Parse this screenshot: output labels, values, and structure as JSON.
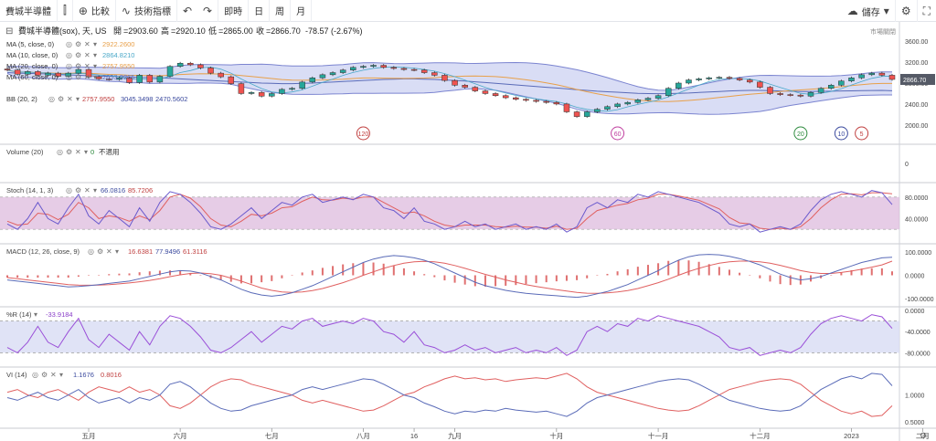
{
  "toolbar": {
    "symbol": "費城半導體",
    "compare_label": "比較",
    "indicators_label": "技術指標",
    "intervals": [
      "即時",
      "日",
      "周",
      "月"
    ],
    "save_label": "儲存"
  },
  "header": {
    "title": "費城半導體(sox), 天, US",
    "open_label": "開",
    "open": "=2903.60",
    "high_label": "高",
    "high": "=2920.10",
    "low_label": "低",
    "low": "=2865.00",
    "close_label": "收",
    "close": "=2866.70",
    "change": "-78.57 (-2.67%)",
    "market_label": "市場關閉"
  },
  "overlays": [
    {
      "label": "MA (5, close, 0)",
      "value": "2922.2600",
      "color": "#e8a04a"
    },
    {
      "label": "MA (10, close, 0)",
      "value": "2864.8210",
      "color": "#4aa8c8"
    },
    {
      "label": "MA (20, close, 0)",
      "value": "2757.9550",
      "color": "#e8a04a"
    },
    {
      "label": "MA (60, close, 0)",
      "value": "2653.0265",
      "color": "#5a6bb8"
    }
  ],
  "bb": {
    "label": "BB (20, 2)",
    "mid": "2757.9550",
    "upper": "3045.3498",
    "lower": "2470.5602"
  },
  "volume": {
    "label": "Volume (20)",
    "value": "0",
    "note": "不適用"
  },
  "stoch": {
    "label": "Stoch (14, 1, 3)",
    "k": "66.0816",
    "d": "85.7206"
  },
  "macd": {
    "label": "MACD (12, 26, close, 9)",
    "hist": "16.6381",
    "macd": "77.9496",
    "signal": "61.3116"
  },
  "willr": {
    "label": "%R (14)",
    "value": "-33.9184"
  },
  "vi": {
    "label": "VI (14)",
    "plus": "1.1676",
    "minus": "0.8016"
  },
  "price_badge": "2866.70",
  "markers": [
    {
      "label": "120",
      "color": "#c04040",
      "index": 35
    },
    {
      "label": "60",
      "color": "#c040a0",
      "index": 60
    },
    {
      "label": "20",
      "color": "#2e8b3e",
      "index": 78
    },
    {
      "label": "10",
      "color": "#3b4a9e",
      "index": 82
    },
    {
      "label": "5",
      "color": "#c04040",
      "index": 84
    }
  ],
  "colors": {
    "up": "#26a69a",
    "down": "#ef5350",
    "bb_fill": "#c5cbf0",
    "bb_line": "#7b84d0",
    "stoch_fill": "#dbb6dc",
    "stoch_k": "#6a5acd",
    "stoch_d": "#e06060",
    "macd_line": "#5a6bb8",
    "signal_line": "#e06060",
    "hist": "#e07070",
    "willr_fill": "#d8dcf4",
    "willr_line": "#9a4fd8",
    "vi_plus": "#5a6bb8",
    "vi_minus": "#e06060"
  },
  "chart_data": {
    "type": "line",
    "x_ticks": [
      "五月",
      "六月",
      "七月",
      "八月",
      "16",
      "九月",
      "十月",
      "十一月",
      "十二月",
      "2023",
      "二月"
    ],
    "x_tick_index": [
      8,
      17,
      26,
      35,
      40,
      44,
      54,
      64,
      74,
      83,
      90
    ],
    "price": {
      "ylim": [
        1700,
        3900
      ],
      "y_ticks": [
        3600,
        3200,
        2800,
        2400,
        2000
      ],
      "y_tick_labels": [
        "3600.00",
        "3200.00",
        "2800.00",
        "2400.00",
        "2000.00"
      ],
      "close": [
        3050,
        2970,
        3020,
        2950,
        2990,
        2930,
        2990,
        3060,
        2920,
        2880,
        2870,
        2900,
        2810,
        2950,
        2820,
        2930,
        3120,
        3180,
        3150,
        3090,
        2990,
        2920,
        2790,
        2600,
        2620,
        2550,
        2600,
        2680,
        2700,
        2820,
        2900,
        2960,
        3000,
        3050,
        3100,
        3120,
        3140,
        3100,
        3080,
        3060,
        3050,
        3000,
        2950,
        2850,
        2760,
        2720,
        2650,
        2600,
        2560,
        2520,
        2490,
        2470,
        2450,
        2430,
        2400,
        2250,
        2160,
        2250,
        2300,
        2350,
        2400,
        2430,
        2480,
        2510,
        2560,
        2700,
        2800,
        2860,
        2880,
        2900,
        2910,
        2890,
        2860,
        2820,
        2720,
        2600,
        2580,
        2570,
        2550,
        2620,
        2700,
        2760,
        2840,
        2900,
        2960,
        2990,
        2950,
        2870
      ],
      "ma_long": [
        3000,
        2990,
        2985,
        2980,
        2975,
        2965,
        2955,
        2950,
        2940,
        2935,
        2930,
        2925,
        2920,
        2910,
        2905,
        2900,
        2890,
        2880,
        2870,
        2860,
        2850,
        2840,
        2830,
        2820,
        2810,
        2800,
        2795,
        2790,
        2790,
        2795,
        2800,
        2810,
        2820,
        2830,
        2840,
        2850,
        2860,
        2870,
        2875,
        2880,
        2880,
        2875,
        2870,
        2860,
        2850,
        2840,
        2825,
        2810,
        2795,
        2780,
        2765,
        2750,
        2735,
        2720,
        2705,
        2690,
        2675,
        2660,
        2645,
        2635,
        2625,
        2615,
        2605,
        2600,
        2598,
        2600,
        2605,
        2610,
        2620,
        2630,
        2640,
        2650,
        2655,
        2660,
        2660,
        2655,
        2650,
        2645,
        2640,
        2640,
        2642,
        2645,
        2650,
        2652,
        2655,
        2658,
        2660,
        2653
      ]
    },
    "volume": {
      "ylim": [
        -1,
        1
      ],
      "y_ticks": [
        0
      ],
      "y_tick_labels": [
        "0"
      ]
    },
    "stoch": {
      "ylim": [
        0,
        100
      ],
      "band": [
        20,
        80
      ],
      "y_ticks": [
        80,
        40
      ],
      "y_tick_labels": [
        "80.0000",
        "40.0000"
      ],
      "k": [
        30,
        20,
        40,
        70,
        40,
        30,
        60,
        85,
        45,
        30,
        55,
        40,
        25,
        60,
        35,
        70,
        90,
        85,
        70,
        50,
        25,
        20,
        30,
        45,
        60,
        40,
        55,
        70,
        65,
        80,
        85,
        70,
        75,
        80,
        75,
        85,
        80,
        60,
        55,
        40,
        60,
        35,
        30,
        20,
        25,
        35,
        25,
        30,
        20,
        25,
        30,
        20,
        25,
        20,
        30,
        15,
        25,
        60,
        70,
        60,
        75,
        70,
        85,
        80,
        90,
        85,
        80,
        75,
        70,
        60,
        50,
        30,
        25,
        30,
        15,
        20,
        25,
        20,
        30,
        55,
        75,
        85,
        90,
        85,
        80,
        92,
        88,
        66
      ],
      "d": [
        35,
        28,
        30,
        50,
        48,
        38,
        48,
        70,
        60,
        40,
        45,
        42,
        35,
        45,
        38,
        55,
        80,
        85,
        78,
        62,
        40,
        28,
        25,
        35,
        48,
        45,
        50,
        60,
        62,
        72,
        80,
        75,
        74,
        78,
        76,
        80,
        80,
        70,
        60,
        50,
        52,
        45,
        35,
        28,
        25,
        28,
        28,
        28,
        25,
        24,
        26,
        24,
        24,
        22,
        26,
        20,
        22,
        40,
        55,
        60,
        65,
        68,
        75,
        78,
        85,
        85,
        82,
        78,
        74,
        66,
        58,
        42,
        32,
        30,
        22,
        20,
        22,
        20,
        25,
        40,
        60,
        75,
        85,
        86,
        84,
        88,
        88,
        86
      ]
    },
    "macd": {
      "ylim": [
        -120,
        120
      ],
      "y_ticks": [
        100,
        0,
        -100
      ],
      "y_tick_labels": [
        "100.0000",
        "0.0000",
        "-100.0000"
      ],
      "macd": [
        -20,
        -25,
        -30,
        -35,
        -40,
        -45,
        -50,
        -48,
        -45,
        -40,
        -35,
        -30,
        -25,
        -15,
        -5,
        5,
        15,
        20,
        18,
        10,
        -5,
        -20,
        -40,
        -60,
        -75,
        -85,
        -90,
        -85,
        -75,
        -60,
        -45,
        -25,
        -5,
        15,
        35,
        55,
        70,
        80,
        85,
        82,
        75,
        65,
        50,
        30,
        10,
        -10,
        -30,
        -45,
        -55,
        -65,
        -72,
        -78,
        -82,
        -85,
        -88,
        -92,
        -95,
        -90,
        -80,
        -70,
        -55,
        -40,
        -20,
        0,
        20,
        45,
        65,
        80,
        88,
        90,
        88,
        82,
        72,
        60,
        45,
        25,
        5,
        -10,
        -20,
        -15,
        -5,
        10,
        25,
        40,
        55,
        65,
        75,
        78
      ],
      "signal": [
        -10,
        -15,
        -20,
        -25,
        -30,
        -35,
        -40,
        -42,
        -43,
        -42,
        -40,
        -37,
        -33,
        -28,
        -22,
        -15,
        -6,
        2,
        8,
        10,
        7,
        0,
        -12,
        -25,
        -40,
        -55,
        -65,
        -72,
        -74,
        -72,
        -66,
        -57,
        -45,
        -32,
        -17,
        0,
        15,
        30,
        42,
        52,
        58,
        60,
        58,
        52,
        42,
        30,
        17,
        4,
        -8,
        -20,
        -30,
        -40,
        -48,
        -55,
        -62,
        -68,
        -74,
        -77,
        -78,
        -76,
        -72,
        -66,
        -57,
        -45,
        -32,
        -17,
        0,
        16,
        30,
        42,
        52,
        58,
        61,
        61,
        58,
        52,
        43,
        32,
        20,
        12,
        8,
        8,
        12,
        18,
        26,
        35,
        45,
        61
      ]
    },
    "willr": {
      "ylim": [
        -100,
        0
      ],
      "band": [
        -80,
        -20
      ],
      "y_ticks": [
        0,
        -40,
        -80
      ],
      "y_tick_labels": [
        "0.0000",
        "-40.0000",
        "-80.0000"
      ],
      "values": [
        -70,
        -80,
        -60,
        -30,
        -60,
        -70,
        -40,
        -15,
        -55,
        -70,
        -45,
        -60,
        -75,
        -40,
        -65,
        -30,
        -10,
        -15,
        -30,
        -50,
        -75,
        -80,
        -70,
        -55,
        -40,
        -60,
        -45,
        -30,
        -35,
        -20,
        -15,
        -30,
        -25,
        -20,
        -25,
        -15,
        -20,
        -40,
        -45,
        -60,
        -40,
        -65,
        -70,
        -80,
        -75,
        -65,
        -75,
        -70,
        -80,
        -75,
        -70,
        -80,
        -75,
        -80,
        -70,
        -85,
        -75,
        -40,
        -30,
        -40,
        -25,
        -30,
        -15,
        -20,
        -10,
        -15,
        -20,
        -25,
        -30,
        -40,
        -50,
        -70,
        -75,
        -70,
        -85,
        -80,
        -75,
        -80,
        -70,
        -45,
        -25,
        -15,
        -10,
        -15,
        -20,
        -8,
        -12,
        -34
      ]
    },
    "vi": {
      "ylim": [
        0.45,
        1.45
      ],
      "y_ticks": [
        1.0,
        0.5
      ],
      "y_tick_labels": [
        "1.0000",
        "0.5000"
      ],
      "plus": [
        0.95,
        0.9,
        0.98,
        1.05,
        0.95,
        0.9,
        1.0,
        1.1,
        0.95,
        0.85,
        0.9,
        0.95,
        0.85,
        0.95,
        0.9,
        1.0,
        1.2,
        1.25,
        1.15,
        1.0,
        0.85,
        0.75,
        0.7,
        0.72,
        0.8,
        0.85,
        0.9,
        0.95,
        1.0,
        1.1,
        1.15,
        1.1,
        1.15,
        1.2,
        1.25,
        1.3,
        1.28,
        1.2,
        1.1,
        1.0,
        0.95,
        0.85,
        0.78,
        0.7,
        0.65,
        0.7,
        0.68,
        0.72,
        0.7,
        0.75,
        0.72,
        0.7,
        0.68,
        0.7,
        0.65,
        0.6,
        0.7,
        0.85,
        0.95,
        1.0,
        1.05,
        1.1,
        1.15,
        1.2,
        1.25,
        1.28,
        1.3,
        1.28,
        1.2,
        1.1,
        1.0,
        0.9,
        0.85,
        0.8,
        0.75,
        0.72,
        0.7,
        0.72,
        0.8,
        0.95,
        1.1,
        1.2,
        1.3,
        1.35,
        1.3,
        1.4,
        1.38,
        1.17
      ],
      "minus": [
        1.05,
        1.1,
        1.0,
        0.95,
        1.05,
        1.1,
        1.0,
        0.9,
        1.05,
        1.15,
        1.1,
        1.05,
        1.15,
        1.05,
        1.1,
        1.0,
        0.8,
        0.75,
        0.85,
        1.0,
        1.15,
        1.25,
        1.3,
        1.28,
        1.2,
        1.15,
        1.1,
        1.05,
        1.0,
        0.9,
        0.85,
        0.9,
        0.85,
        0.8,
        0.75,
        0.7,
        0.72,
        0.8,
        0.9,
        1.0,
        1.05,
        1.15,
        1.22,
        1.3,
        1.35,
        1.3,
        1.32,
        1.28,
        1.3,
        1.25,
        1.28,
        1.3,
        1.32,
        1.3,
        1.35,
        1.4,
        1.3,
        1.15,
        1.05,
        1.0,
        0.95,
        0.9,
        0.85,
        0.8,
        0.75,
        0.72,
        0.7,
        0.72,
        0.8,
        0.9,
        1.0,
        1.1,
        1.15,
        1.2,
        1.25,
        1.28,
        1.3,
        1.28,
        1.2,
        1.05,
        0.9,
        0.8,
        0.7,
        0.65,
        0.7,
        0.6,
        0.62,
        0.8
      ]
    }
  }
}
